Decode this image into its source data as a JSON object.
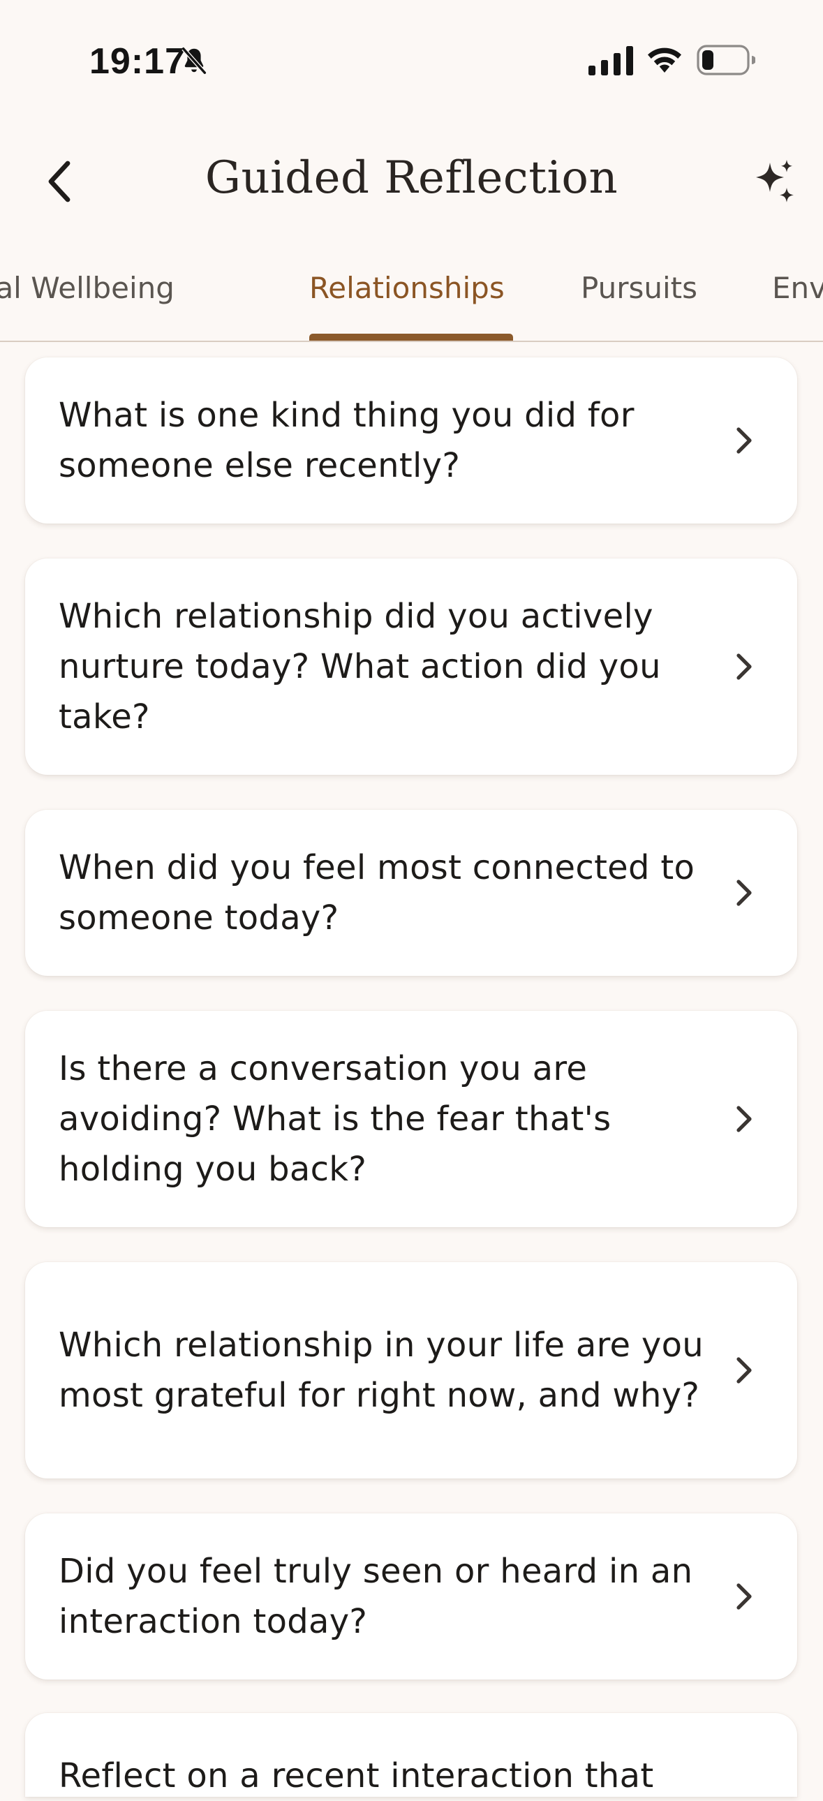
{
  "status_bar": {
    "time": "19:17",
    "icons": [
      "bell-slash-icon",
      "cellular-signal-icon",
      "wifi-icon",
      "battery-icon"
    ]
  },
  "header": {
    "title": "Guided Reflection",
    "back_icon": "chevron-left-icon",
    "action_icon": "sparkles-icon"
  },
  "tabs": [
    {
      "label": "Physical Wellbeing",
      "active": false
    },
    {
      "label": "Relationships",
      "active": true
    },
    {
      "label": "Pursuits",
      "active": false
    },
    {
      "label": "Environment",
      "active": false
    }
  ],
  "prompts": [
    {
      "text": "What is one kind thing you did for someone else recently?"
    },
    {
      "text": "Which relationship did you actively nurture today? What action did you take?"
    },
    {
      "text": "When did you feel most connected to someone today?"
    },
    {
      "text": "Is there a conversation you are avoiding? What is the fear that's holding you back?"
    },
    {
      "text": "Which relationship in your life are you most grateful for right now, and why?"
    },
    {
      "text": "Did you feel truly seen or heard in an interaction today?"
    },
    {
      "text": "Reflect on a recent interaction that"
    }
  ],
  "colors": {
    "background": "#fcf8f5",
    "accent": "#8b5a2b",
    "card": "#ffffff",
    "text": "#1d1b19"
  }
}
